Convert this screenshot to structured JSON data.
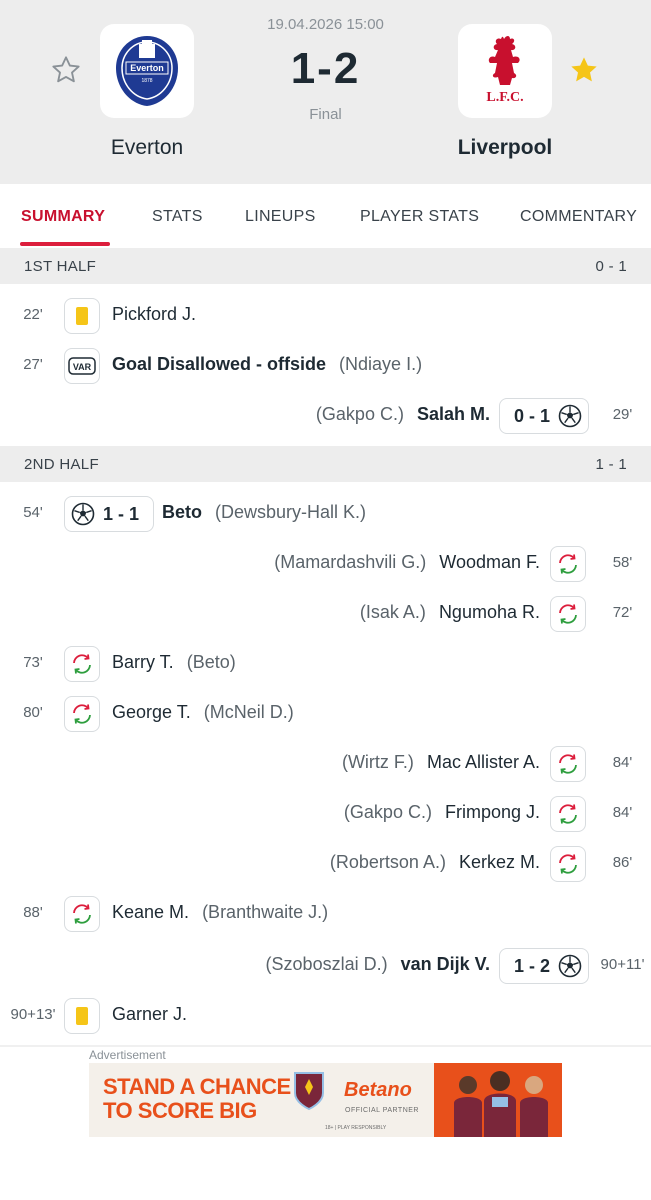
{
  "match": {
    "date_time": "19.04.2026 15:00",
    "score": "1-2",
    "status": "Final",
    "home_team": "Everton",
    "away_team": "Liverpool",
    "home_favorite": false,
    "away_favorite": true
  },
  "tabs": [
    {
      "label": "SUMMARY",
      "active": true
    },
    {
      "label": "STATS",
      "active": false
    },
    {
      "label": "LINEUPS",
      "active": false
    },
    {
      "label": "PLAYER STATS",
      "active": false
    },
    {
      "label": "COMMENTARY",
      "active": false
    }
  ],
  "sections": [
    {
      "title": "1ST HALF",
      "score": "0 - 1"
    },
    {
      "title": "2ND HALF",
      "score": "1 - 1"
    }
  ],
  "events": [
    {
      "minute": "22'",
      "side": "home",
      "type": "yellow-card",
      "player": "Pickford J.",
      "assist": ""
    },
    {
      "minute": "27'",
      "side": "home",
      "type": "var",
      "player": "Goal Disallowed - offside",
      "assist": "(Ndiaye I.)"
    },
    {
      "minute": "29'",
      "side": "away",
      "type": "goal",
      "score": "0 - 1",
      "player": "Salah M.",
      "assist": "(Gakpo C.)"
    },
    {
      "minute": "54'",
      "side": "home",
      "type": "goal",
      "score": "1 - 1",
      "player": "Beto",
      "assist": "(Dewsbury-Hall K.)"
    },
    {
      "minute": "58'",
      "side": "away",
      "type": "substitution",
      "player": "Woodman F.",
      "assist": "(Mamardashvili G.)"
    },
    {
      "minute": "72'",
      "side": "away",
      "type": "substitution",
      "player": "Ngumoha R.",
      "assist": "(Isak A.)"
    },
    {
      "minute": "73'",
      "side": "home",
      "type": "substitution",
      "player": "Barry T.",
      "assist": "(Beto)"
    },
    {
      "minute": "80'",
      "side": "home",
      "type": "substitution",
      "player": "George T.",
      "assist": "(McNeil D.)"
    },
    {
      "minute": "84'",
      "side": "away",
      "type": "substitution",
      "player": "Mac Allister A.",
      "assist": "(Wirtz F.)"
    },
    {
      "minute": "84'",
      "side": "away",
      "type": "substitution",
      "player": "Frimpong J.",
      "assist": "(Gakpo C.)"
    },
    {
      "minute": "86'",
      "side": "away",
      "type": "substitution",
      "player": "Kerkez M.",
      "assist": "(Robertson A.)"
    },
    {
      "minute": "88'",
      "side": "home",
      "type": "substitution",
      "player": "Keane M.",
      "assist": "(Branthwaite J.)"
    },
    {
      "minute": "90+11'",
      "side": "away",
      "type": "goal",
      "score": "1 - 2",
      "player": "van Dijk V.",
      "assist": "(Szoboszlai D.)"
    },
    {
      "minute": "90+13'",
      "side": "home",
      "type": "yellow-card",
      "player": "Garner J.",
      "assist": ""
    }
  ],
  "ad": {
    "label": "Advertisement",
    "headline_line1": "STAND A CHANCE",
    "headline_line2": "TO SCORE BIG",
    "brand": "Betano",
    "partner_text": "OFFICIAL PARTNER",
    "tagline": "18+ | PLAY RESPONSIBLY"
  },
  "colors": {
    "accent": "#c8102e",
    "yellow_card": "#f5c518",
    "sub_in": "#2e9e3e",
    "sub_out": "#dc1e3c",
    "everton_blue": "#1f3a93",
    "liverpool_red": "#c8102e"
  },
  "icons": {
    "star_off": "star-outline-icon",
    "star_on": "star-filled-icon",
    "yellow_card": "yellow-card-icon",
    "var": "var-icon",
    "goal": "football-icon",
    "substitution": "substitution-icon"
  }
}
